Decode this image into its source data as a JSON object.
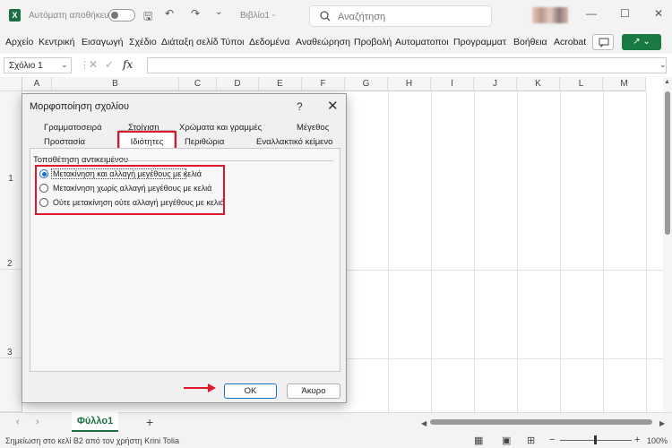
{
  "titlebar": {
    "autosave_label": "Αυτόματη αποθήκευση",
    "document_title": "Βιβλίο1 -",
    "search_placeholder": "Αναζήτηση",
    "logo_text": "X"
  },
  "ribbon": {
    "menu": [
      "Αρχείο",
      "Κεντρική",
      "Εισαγωγή",
      "Σχέδιο",
      "Διάταξη σελίδ",
      "Τύποι",
      "Δεδομένα",
      "Αναθεώρηση",
      "Προβολή",
      "Αυτοματοποι",
      "Προγραμματ",
      "Βοήθεια",
      "Acrobat"
    ]
  },
  "formula_bar": {
    "name_box": "Σχόλιο 1",
    "fx_label": "fx",
    "formula": ""
  },
  "grid": {
    "columns": [
      "A",
      "B",
      "C",
      "D",
      "E",
      "F",
      "G",
      "H",
      "I",
      "J",
      "K",
      "L",
      "M"
    ],
    "rows": [
      "1",
      "2",
      "3"
    ]
  },
  "sheet_tabs": {
    "active": "Φύλλο1",
    "add": "+"
  },
  "status": {
    "text": "Σημείωση στο κελί B2 από τον χρήστη Krini Tolia",
    "zoom": "100%"
  },
  "dialog": {
    "title": "Μορφοποίηση σχολίου",
    "help": "?",
    "close": "✕",
    "tabs_row1": [
      "Γραμματοσειρά",
      "Στοίχιση",
      "Χρώματα και γραμμές",
      "Μέγεθος"
    ],
    "tabs_row2": [
      "Προστασία",
      "Ιδιότητες",
      "Περιθώρια",
      "Εναλλακτικό κείμενο"
    ],
    "group_label": "Τοποθέτηση αντικειμένου",
    "options": [
      {
        "label": "Μετακίνηση και αλλαγή μεγέθους με κελιά",
        "checked": true
      },
      {
        "label": "Μετακίνηση χωρίς αλλαγή μεγέθους με κελιά",
        "checked": false
      },
      {
        "label": "Ούτε μετακίνηση ούτε αλλαγή μεγέθους με κελιά",
        "checked": false
      }
    ],
    "ok_label": "OK",
    "cancel_label": "Άκυρο"
  },
  "colors": {
    "excel_green": "#1d6f42",
    "highlight_red": "#e0182b",
    "radio_blue": "#1a6fc9"
  }
}
